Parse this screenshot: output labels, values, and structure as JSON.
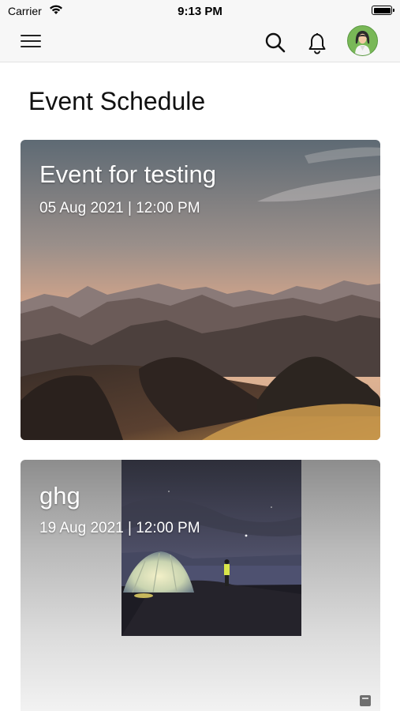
{
  "status_bar": {
    "carrier": "Carrier",
    "time": "9:13 PM"
  },
  "header": {
    "menu_icon": "hamburger-menu-icon",
    "search_icon": "search-icon",
    "notification_icon": "bell-icon",
    "avatar_icon": "user-avatar"
  },
  "page": {
    "title": "Event Schedule"
  },
  "events": [
    {
      "title": "Event for testing",
      "datetime": "05 Aug 2021 | 12:00 PM",
      "image": "mountain-sunset"
    },
    {
      "title": "ghg",
      "datetime": "19 Aug 2021 | 12:00 PM",
      "image": "tent-night-sky"
    }
  ],
  "colors": {
    "background": "#ffffff",
    "appbar": "#f7f7f7",
    "text": "#111111",
    "card_text": "#ffffff"
  }
}
